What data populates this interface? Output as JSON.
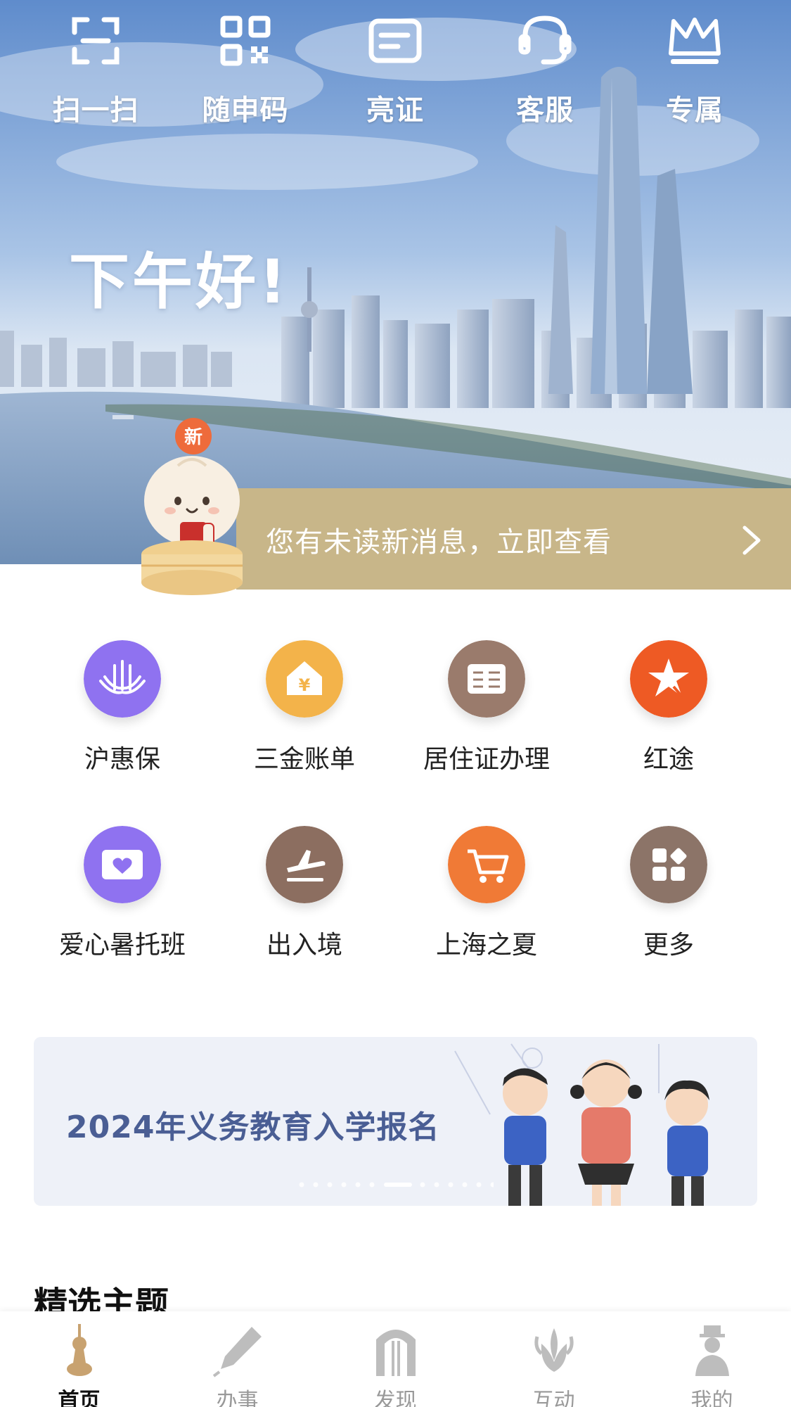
{
  "quick_bar": {
    "items": [
      {
        "label": "扫一扫",
        "icon": "scan-icon"
      },
      {
        "label": "随申码",
        "icon": "qr-code-icon"
      },
      {
        "label": "亮证",
        "icon": "id-card-icon"
      },
      {
        "label": "客服",
        "icon": "headset-icon"
      },
      {
        "label": "专属",
        "icon": "crown-icon"
      }
    ]
  },
  "hero": {
    "greeting": "下午好!",
    "message": "您有未读新消息，立即查看",
    "mascot_badge": "新"
  },
  "services": [
    {
      "label": "沪惠保",
      "icon": "lotus-icon",
      "color": "#8f72f0"
    },
    {
      "label": "三金账单",
      "icon": "house-yen-icon",
      "color": "#f3b34a"
    },
    {
      "label": "居住证办理",
      "icon": "residence-card-icon",
      "color": "#9a7b6c"
    },
    {
      "label": "红途",
      "icon": "red-star-flag-icon",
      "color": "#ee5a24"
    },
    {
      "label": "爱心暑托班",
      "icon": "heart-book-icon",
      "color": "#8f72f0"
    },
    {
      "label": "出入境",
      "icon": "airplane-icon",
      "color": "#8c6e60"
    },
    {
      "label": "上海之夏",
      "icon": "shopping-cart-icon",
      "color": "#f07a36"
    },
    {
      "label": "更多",
      "icon": "grid-more-icon",
      "color": "#8c7468"
    }
  ],
  "banner": {
    "title": "2024年义务教育入学报名",
    "slides_total": 14,
    "slide_active": 6
  },
  "section": {
    "title": "精选主题"
  },
  "tabbar": {
    "items": [
      {
        "label": "首页",
        "icon": "oriental-pearl-tower-icon",
        "active": true
      },
      {
        "label": "办事",
        "icon": "pen-icon",
        "active": false
      },
      {
        "label": "发现",
        "icon": "stone-gate-icon",
        "active": false
      },
      {
        "label": "互动",
        "icon": "magnolia-icon",
        "active": false
      },
      {
        "label": "我的",
        "icon": "person-icon",
        "active": false
      }
    ]
  },
  "colors": {
    "accent_gold": "#c8b689",
    "tab_active": "#111111",
    "tab_inactive": "#999999"
  }
}
